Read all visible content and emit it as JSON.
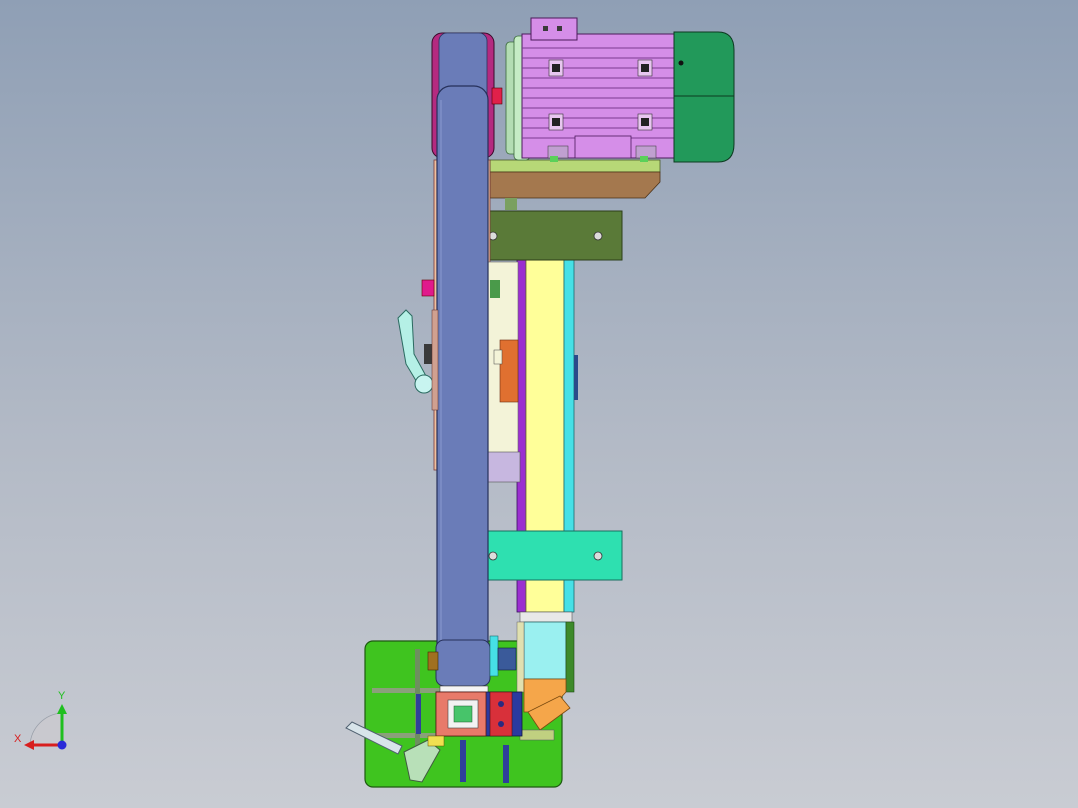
{
  "viewport": {
    "background_top": "#8f9fb5",
    "background_bottom": "#c9ccd3"
  },
  "triad": {
    "x_label": "X",
    "y_label": "Y",
    "x_color": "#d81e1e",
    "y_color": "#1fbf1f",
    "z_color": "#2a2ad8"
  },
  "parts": {
    "motor_body_color": "#d58ee8",
    "motor_fan_cover_color": "#22995a",
    "belt_color": "#6a7cb8",
    "mount_plate_color": "#5a7a38",
    "clamp_plate_color": "#2ee0b0",
    "column_color": "#ffff99",
    "column_edge_color": "#9b2fd0",
    "base_plate_color": "#3fc41f",
    "motor_shelf_color": "#a4784e",
    "block_color": "#9af0f0",
    "wedge_color": "#f5a64a"
  }
}
